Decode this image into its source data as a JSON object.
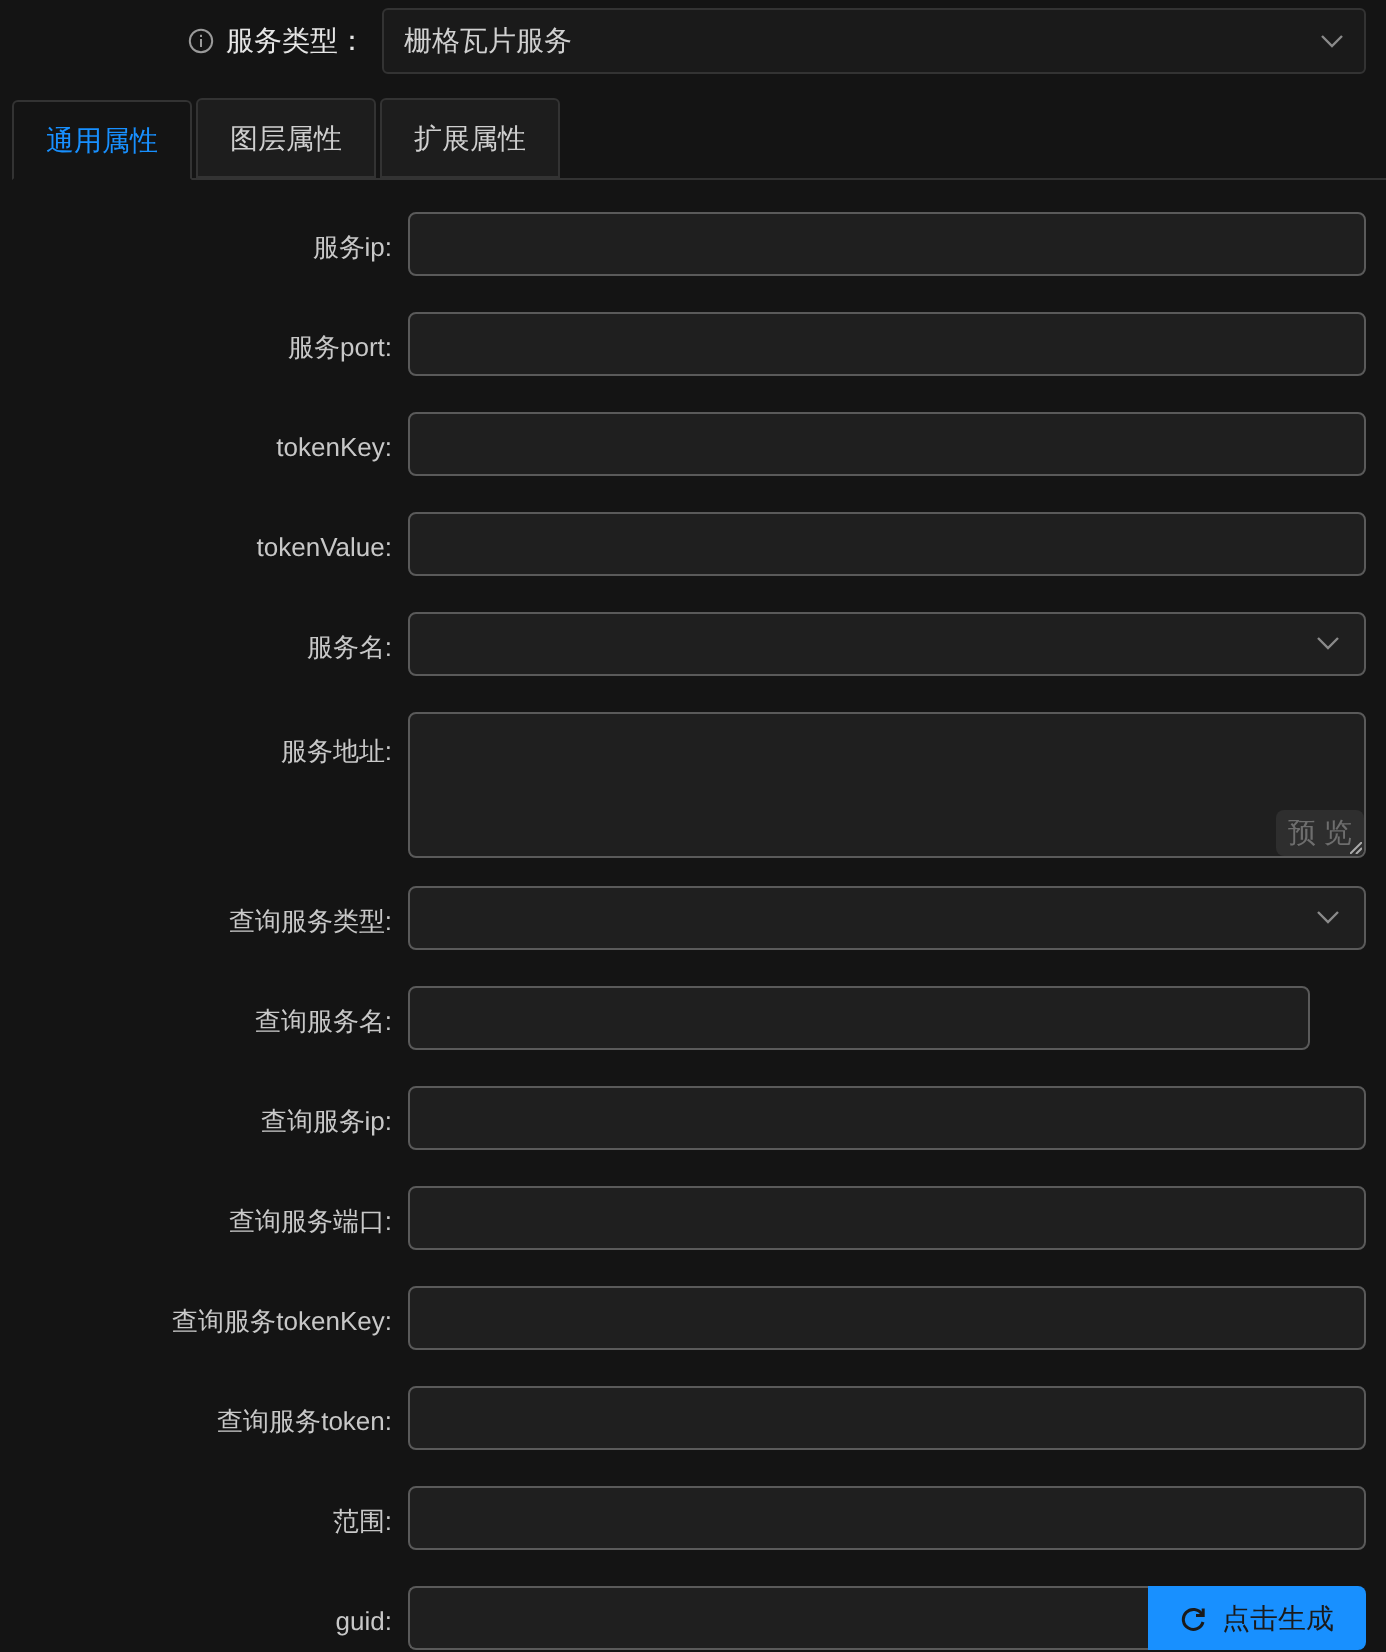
{
  "service_type": {
    "label": "服务类型：",
    "value": "栅格瓦片服务"
  },
  "tabs": [
    {
      "label": "通用属性",
      "selected": true
    },
    {
      "label": "图层属性",
      "selected": false
    },
    {
      "label": "扩展属性",
      "selected": false
    }
  ],
  "fields": [
    {
      "label": "服务ip:",
      "kind": "input"
    },
    {
      "label": "服务port:",
      "kind": "input"
    },
    {
      "label": "tokenKey:",
      "kind": "input"
    },
    {
      "label": "tokenValue:",
      "kind": "input"
    },
    {
      "label": "服务名:",
      "kind": "select"
    },
    {
      "label": "服务地址:",
      "kind": "textarea",
      "button": "预 览"
    },
    {
      "label": "查询服务类型:",
      "kind": "select"
    },
    {
      "label": "查询服务名:",
      "kind": "short"
    },
    {
      "label": "查询服务ip:",
      "kind": "input"
    },
    {
      "label": "查询服务端口:",
      "kind": "input"
    },
    {
      "label": "查询服务tokenKey:",
      "kind": "input"
    },
    {
      "label": "查询服务token:",
      "kind": "input"
    },
    {
      "label": "范围:",
      "kind": "input"
    },
    {
      "label": "guid:",
      "kind": "button",
      "button": "点击生成"
    }
  ]
}
